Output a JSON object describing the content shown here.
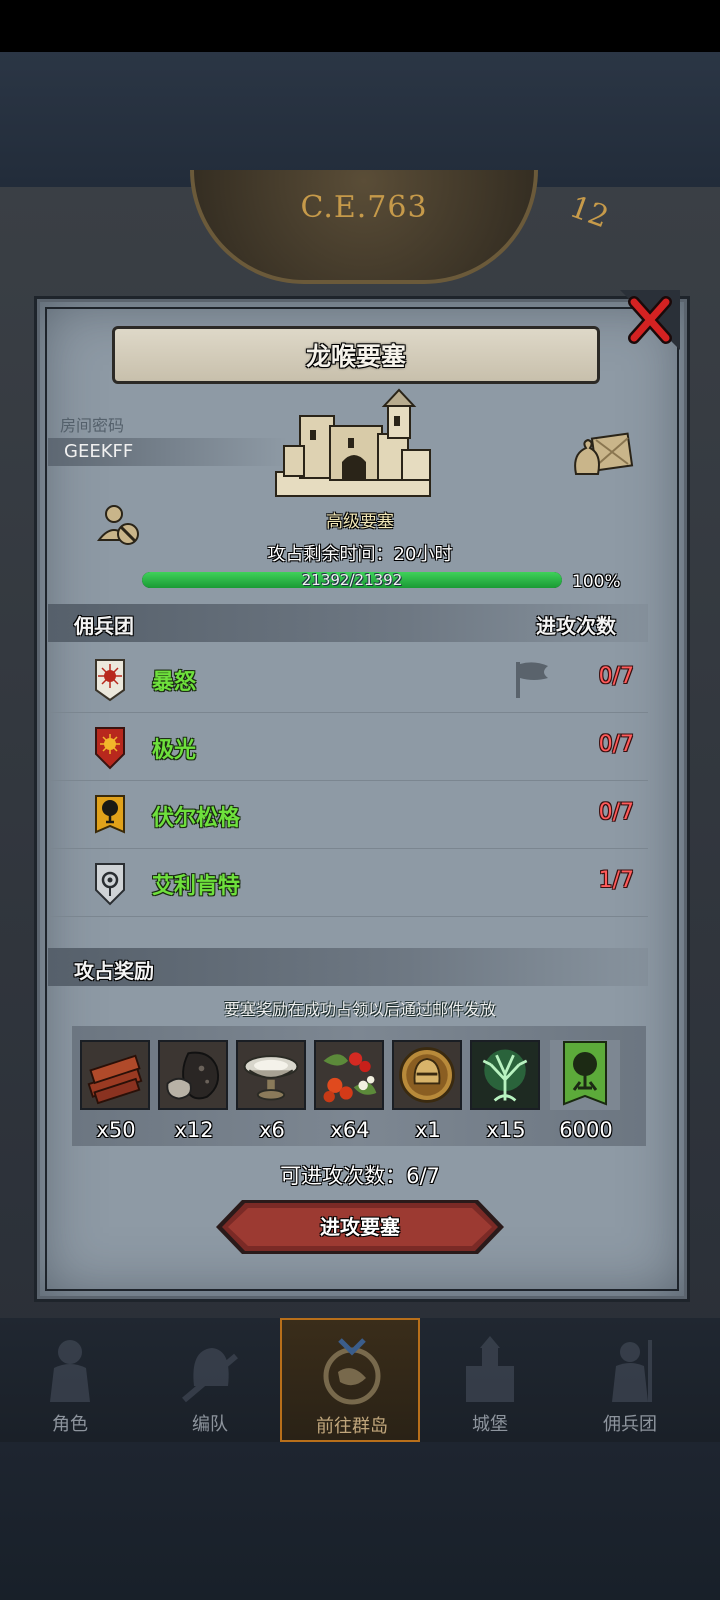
{
  "background": {
    "era": "C.E.763",
    "clock_numeral": "12"
  },
  "fortress": {
    "title": "龙喉要塞",
    "room_label": "房间密码",
    "room_code": "GEEKFF",
    "grade": "高级要塞",
    "time_left": "攻占剩余时间：20小时",
    "hp_text": "21392/21392",
    "hp_percent": "100%",
    "hp_fraction": 1.0
  },
  "mercenaries": {
    "header_left": "佣兵团",
    "header_right": "进攻次数",
    "rows": [
      {
        "name": "暴怒",
        "count": "0/7",
        "badge": "sun-sigil-icon",
        "badge_color": "#ece8dc"
      },
      {
        "name": "极光",
        "count": "0/7",
        "badge": "sun-sigil-icon",
        "badge_color": "#b8281d"
      },
      {
        "name": "伏尔松格",
        "count": "0/7",
        "badge": "tree-sigil-icon",
        "badge_color": "#e2a21a"
      },
      {
        "name": "艾利肯特",
        "count": "1/7",
        "badge": "eye-sigil-icon",
        "badge_color": "#cfd3d6"
      }
    ]
  },
  "rewards": {
    "header": "攻占奖励",
    "note": "要塞奖励在成功占领以后通过邮件发放",
    "items": [
      {
        "icon": "wood-logs-icon",
        "qty": "x50"
      },
      {
        "icon": "coal-ore-icon",
        "qty": "x12"
      },
      {
        "icon": "silver-bowl-icon",
        "qty": "x6"
      },
      {
        "icon": "berries-icon",
        "qty": "x64"
      },
      {
        "icon": "knight-helmet-medal-icon",
        "qty": "x1"
      },
      {
        "icon": "green-tree-spirit-icon",
        "qty": "x15"
      },
      {
        "icon": "tree-banner-icon",
        "qty": "6000"
      }
    ]
  },
  "attempts": "可进攻次数：6/7",
  "attack_button": "进攻要塞",
  "nav": [
    {
      "label": "角色",
      "icon": "knight-icon"
    },
    {
      "label": "编队",
      "icon": "helmet-sword-icon"
    },
    {
      "label": "前往群岛",
      "icon": "compass-map-icon"
    },
    {
      "label": "城堡",
      "icon": "castle-icon"
    },
    {
      "label": "佣兵团",
      "icon": "soldier-icon"
    }
  ]
}
